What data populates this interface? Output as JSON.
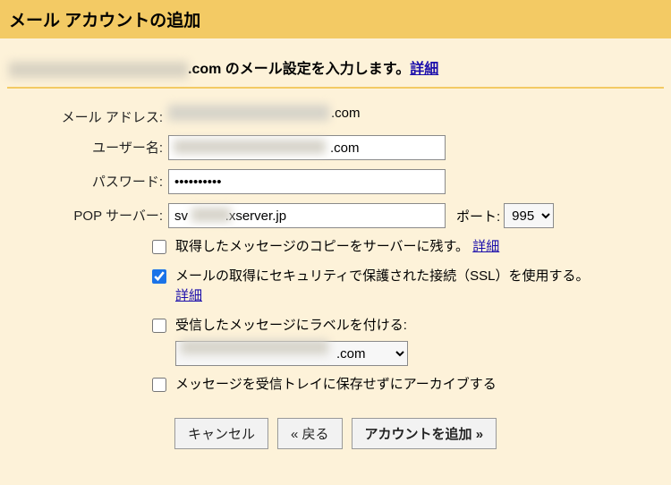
{
  "header": {
    "title": "メール アカウントの追加"
  },
  "subtitle": {
    "domain_suffix": ".com",
    "text": " のメール設定を入力します。",
    "details_link": "詳細"
  },
  "form": {
    "email_label": "メール アドレス:",
    "email_domain_suffix": ".com",
    "username_label": "ユーザー名:",
    "username_suffix": ".com",
    "password_label": "パスワード:",
    "password_value": "••••••••••",
    "pop_label": "POP サーバー:",
    "pop_prefix": "sv",
    "pop_suffix": ".xserver.jp",
    "port_label": "ポート:",
    "port_value": "995"
  },
  "options": {
    "leave_copy": {
      "text": "取得したメッセージのコピーをサーバーに残す。",
      "link": "詳細",
      "checked": false
    },
    "ssl": {
      "text": "メールの取得にセキュリティで保護された接続（SSL）を使用する。",
      "link": "詳細",
      "checked": true
    },
    "label": {
      "text": "受信したメッセージにラベルを付ける:",
      "select_suffix": ".com",
      "checked": false
    },
    "archive": {
      "text": "メッセージを受信トレイに保存せずにアーカイブする",
      "checked": false
    }
  },
  "buttons": {
    "cancel": "キャンセル",
    "back": "« 戻る",
    "add": "アカウントを追加 »"
  }
}
